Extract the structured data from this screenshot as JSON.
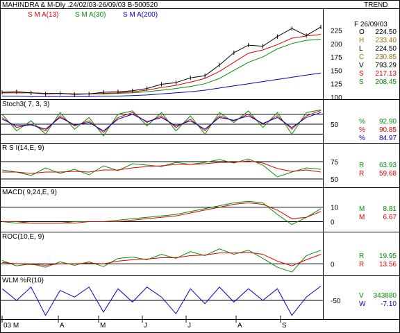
{
  "header": {
    "title": "MAHINDRA & M-Dly .24/02/03-26/09/03  B-500520",
    "trend": "TREND",
    "date_label": "F 26/09/03"
  },
  "legend_sma": [
    {
      "label": "S M A(13)",
      "color": "#e00000"
    },
    {
      "label": "S M A(30)",
      "color": "#009000"
    },
    {
      "label": "S M A(200)",
      "color": "#0000c8"
    }
  ],
  "ohlc": [
    {
      "key": "O",
      "value": "224.50",
      "color": "#000000"
    },
    {
      "key": "H",
      "value": "233.40",
      "color": "#a07000"
    },
    {
      "key": "L",
      "value": "224.50",
      "color": "#000000"
    },
    {
      "key": "C",
      "value": "230.85",
      "color": "#a07000"
    },
    {
      "key": "V",
      "value": "793.29",
      "color": "#000000"
    },
    {
      "key": "S",
      "value": "217.13",
      "color": "#e00000"
    },
    {
      "key": "S",
      "value": "208.45",
      "color": "#009000"
    }
  ],
  "x_axis_labels": [
    "03 M",
    "A",
    "M",
    "J",
    "J",
    "A",
    "S"
  ],
  "colors": {
    "red": "#e00000",
    "green": "#009000",
    "blue": "#0000c8",
    "price": "#000000",
    "frame": "#000000"
  },
  "chart_data": [
    {
      "type": "line",
      "panel": "price",
      "y_ticks": [
        100,
        125,
        150,
        175,
        200,
        225
      ],
      "ylim": [
        100,
        245
      ],
      "series": [
        {
          "name": "S M A(13)",
          "color": "#e00000",
          "values": [
            108,
            108,
            108,
            107,
            107,
            106,
            106,
            107,
            108,
            110,
            113,
            118,
            122,
            128,
            135,
            148,
            165,
            182,
            188,
            198,
            210,
            214,
            217
          ]
        },
        {
          "name": "S M A(30)",
          "color": "#009000",
          "values": [
            108,
            108,
            108,
            107,
            107,
            106,
            106,
            106,
            107,
            108,
            110,
            113,
            116,
            120,
            125,
            135,
            150,
            165,
            175,
            190,
            200,
            206,
            208
          ]
        },
        {
          "name": "S M A(200)",
          "color": "#0000c8",
          "values": [
            102,
            102,
            101,
            101,
            101,
            101,
            101,
            102,
            102,
            103,
            104,
            106,
            108,
            110,
            113,
            117,
            121,
            125,
            129,
            133,
            137,
            141,
            145
          ]
        }
      ],
      "price_close": [
        109,
        110,
        108,
        106,
        107,
        105,
        106,
        109,
        110,
        112,
        116,
        124,
        127,
        136,
        140,
        160,
        183,
        197,
        195,
        213,
        228,
        215,
        231
      ]
    },
    {
      "type": "line",
      "panel": "stochastic",
      "title": "Stoch3( 7, 3, 3)",
      "y_ticks": [
        50
      ],
      "ylim": [
        0,
        100
      ],
      "ref_lines": [
        20,
        80
      ],
      "series": [
        {
          "name": "%",
          "value": "92.90",
          "color": "#009000",
          "values": [
            80,
            30,
            60,
            20,
            85,
            35,
            70,
            15,
            80,
            90,
            45,
            85,
            30,
            75,
            20,
            85,
            55,
            90,
            40,
            85,
            20,
            85,
            93
          ]
        },
        {
          "name": "%",
          "value": "90.85",
          "color": "#e00000",
          "values": [
            70,
            40,
            50,
            30,
            75,
            45,
            60,
            25,
            70,
            85,
            55,
            75,
            40,
            65,
            30,
            75,
            60,
            80,
            50,
            75,
            35,
            75,
            91
          ]
        },
        {
          "name": "%",
          "value": "84.97",
          "color": "#0000c8",
          "values": [
            65,
            45,
            48,
            35,
            70,
            48,
            55,
            30,
            65,
            80,
            58,
            70,
            45,
            60,
            35,
            70,
            62,
            75,
            52,
            70,
            40,
            70,
            85
          ]
        }
      ]
    },
    {
      "type": "line",
      "panel": "rsi",
      "title": "R S I(14,E, 9)",
      "y_ticks": [
        50,
        75
      ],
      "ylim": [
        40,
        90
      ],
      "ref_lines": [
        50,
        75
      ],
      "series": [
        {
          "name": "R",
          "value": "63.93",
          "color": "#009000",
          "values": [
            63,
            60,
            55,
            66,
            58,
            64,
            56,
            69,
            62,
            72,
            70,
            68,
            74,
            71,
            74,
            78,
            73,
            79,
            70,
            53,
            60,
            66,
            64
          ]
        },
        {
          "name": "R",
          "value": "59.68",
          "color": "#e00000",
          "values": [
            60,
            60,
            58,
            60,
            60,
            61,
            60,
            63,
            63,
            66,
            68,
            69,
            71,
            71,
            72,
            74,
            74,
            76,
            73,
            65,
            61,
            63,
            60
          ]
        }
      ]
    },
    {
      "type": "line",
      "panel": "macd",
      "title": "MACD( 9,24,E, 9)",
      "y_ticks": [
        0,
        10
      ],
      "ylim": [
        -6,
        18
      ],
      "series": [
        {
          "name": "M",
          "value": "8.81",
          "color": "#009000",
          "values": [
            0,
            -1,
            -1,
            -1,
            -1,
            0,
            0,
            0,
            1,
            2,
            3,
            4,
            5,
            7,
            9,
            11,
            13,
            14,
            13,
            5,
            -2,
            3,
            9
          ]
        },
        {
          "name": "M",
          "value": "6.67",
          "color": "#e00000",
          "values": [
            0,
            0,
            -1,
            -1,
            -1,
            -1,
            0,
            0,
            0,
            1,
            2,
            3,
            4,
            6,
            8,
            10,
            12,
            13,
            12,
            8,
            2,
            3,
            7
          ]
        }
      ]
    },
    {
      "type": "line",
      "panel": "roc",
      "title": "ROC(10,E, 9)",
      "y_ticks": [
        0
      ],
      "ylim": [
        -15,
        35
      ],
      "series": [
        {
          "name": "R",
          "value": "19.95",
          "color": "#009000",
          "values": [
            5,
            -3,
            0,
            -5,
            3,
            -2,
            3,
            -4,
            8,
            10,
            6,
            14,
            8,
            18,
            12,
            22,
            14,
            20,
            8,
            -5,
            -12,
            12,
            20
          ]
        },
        {
          "name": "R",
          "value": "13.56",
          "color": "#e00000",
          "values": [
            2,
            0,
            -1,
            -2,
            0,
            0,
            1,
            0,
            4,
            6,
            7,
            9,
            9,
            12,
            13,
            16,
            16,
            17,
            14,
            4,
            -3,
            6,
            14
          ]
        }
      ]
    },
    {
      "type": "line",
      "panel": "williams",
      "title": "WLM %R(10)",
      "y_ticks": [
        -50
      ],
      "ylim": [
        -100,
        0
      ],
      "series": [
        {
          "name": "W",
          "value": "-7.10",
          "color": "#0000c8",
          "values": [
            -15,
            -50,
            -10,
            -95,
            -20,
            -40,
            -10,
            -85,
            -15,
            -55,
            -10,
            -40,
            -90,
            -15,
            -60,
            -10,
            -55,
            -15,
            -50,
            -15,
            -95,
            -40,
            -7
          ]
        }
      ],
      "volume": {
        "key": "V",
        "value": "343880"
      }
    }
  ]
}
